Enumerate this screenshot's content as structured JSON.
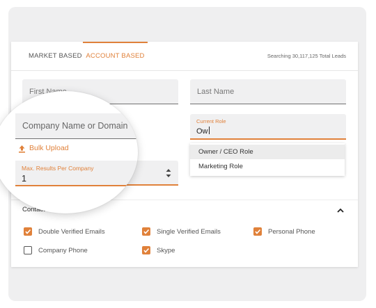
{
  "tabs": [
    {
      "label": "MARKET BASED",
      "active": false
    },
    {
      "label": "ACCOUNT BASED",
      "active": true
    }
  ],
  "search_status": "Searching 30,117,125 Total Leads",
  "form": {
    "first_name_placeholder": "First Name",
    "last_name_placeholder": "Last Name",
    "company_placeholder": "Company Name or Domain",
    "current_role": {
      "label": "Current Role",
      "value": "Ow"
    },
    "role_suggestions": [
      "Owner / CEO Role",
      "Marketing Role"
    ],
    "bulk_upload_label": "Bulk Upload",
    "max_results": {
      "label": "Max. Results Per Company",
      "value": "1"
    }
  },
  "contact": {
    "title": "Contact Me",
    "options": [
      {
        "label": "Double Verified Emails",
        "checked": true
      },
      {
        "label": "Single Verified Emails",
        "checked": true
      },
      {
        "label": "Personal Phone",
        "checked": true
      },
      {
        "label": "Company Phone",
        "checked": false
      },
      {
        "label": "Skype",
        "checked": true
      }
    ]
  },
  "colors": {
    "accent": "#e0813a",
    "field_bg": "#f0f0f1",
    "frame_bg": "#efeff0"
  },
  "icons": {
    "bulk_upload": "upload-icon",
    "collapse": "chevron-up-icon",
    "stepper": "stepper-icon",
    "checkbox": "check-icon"
  }
}
